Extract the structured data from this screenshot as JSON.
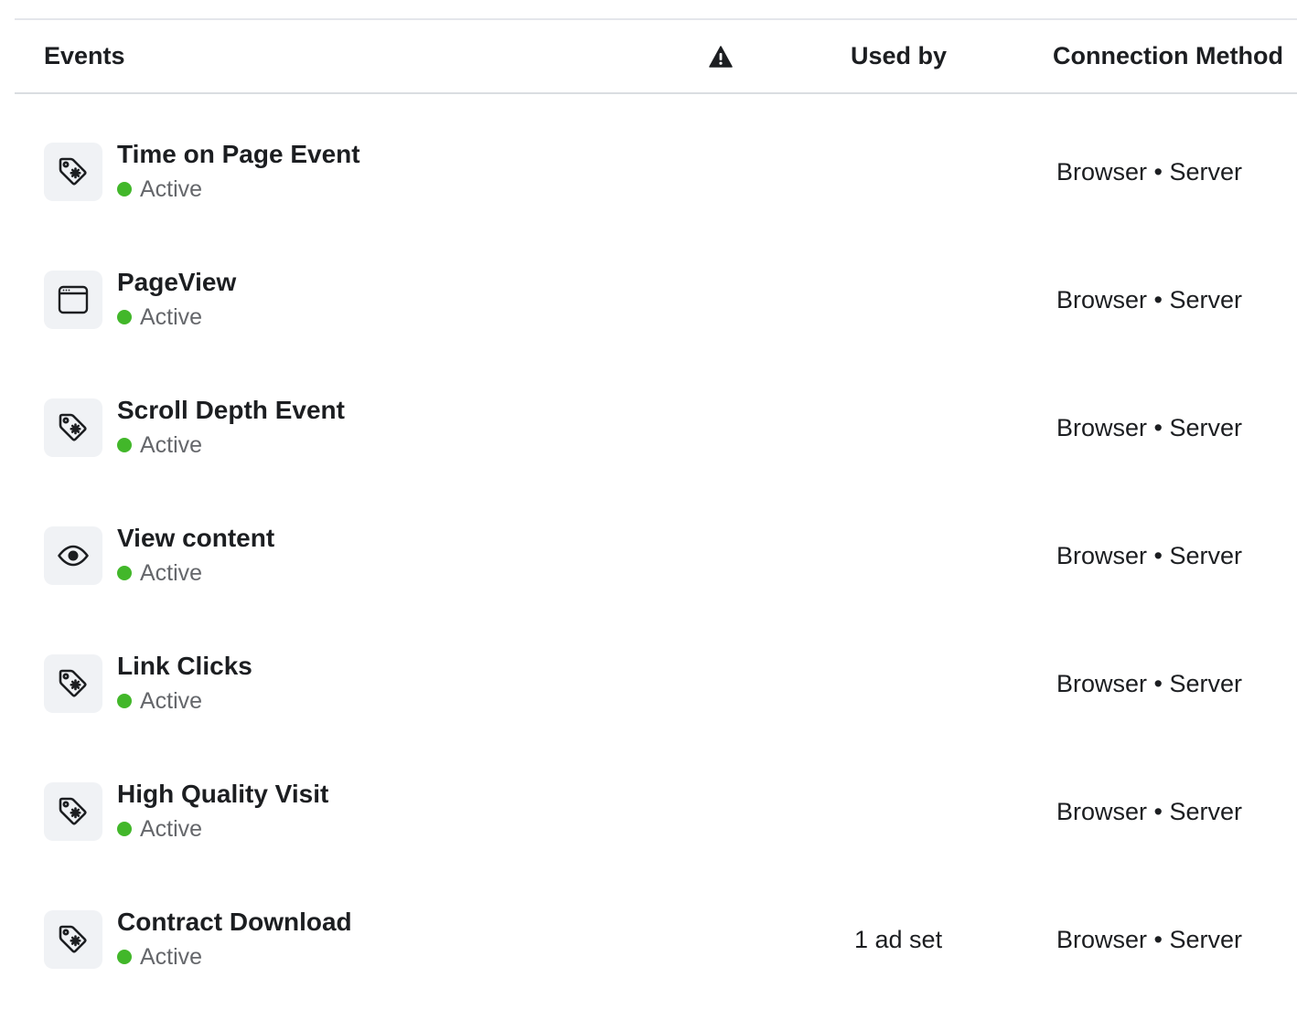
{
  "header": {
    "events": "Events",
    "warning_icon": "warning-icon",
    "used_by": "Used by",
    "connection_method": "Connection Method"
  },
  "colors": {
    "active": "#42b72a",
    "icon_bg": "#f0f2f5",
    "text": "#1c1e21",
    "muted": "#65676b"
  },
  "events": [
    {
      "name": "Time on Page Event",
      "icon": "tag-icon",
      "status": "Active",
      "used_by": "",
      "method": "Browser • Server"
    },
    {
      "name": "PageView",
      "icon": "browser-window-icon",
      "status": "Active",
      "used_by": "",
      "method": "Browser • Server"
    },
    {
      "name": "Scroll Depth Event",
      "icon": "tag-icon",
      "status": "Active",
      "used_by": "",
      "method": "Browser • Server"
    },
    {
      "name": "View content",
      "icon": "eye-icon",
      "status": "Active",
      "used_by": "",
      "method": "Browser • Server"
    },
    {
      "name": "Link Clicks",
      "icon": "tag-icon",
      "status": "Active",
      "used_by": "",
      "method": "Browser • Server"
    },
    {
      "name": "High Quality Visit",
      "icon": "tag-icon",
      "status": "Active",
      "used_by": "",
      "method": "Browser • Server"
    },
    {
      "name": "Contract Download",
      "icon": "tag-icon",
      "status": "Active",
      "used_by": "1 ad set",
      "method": "Browser • Server"
    }
  ]
}
